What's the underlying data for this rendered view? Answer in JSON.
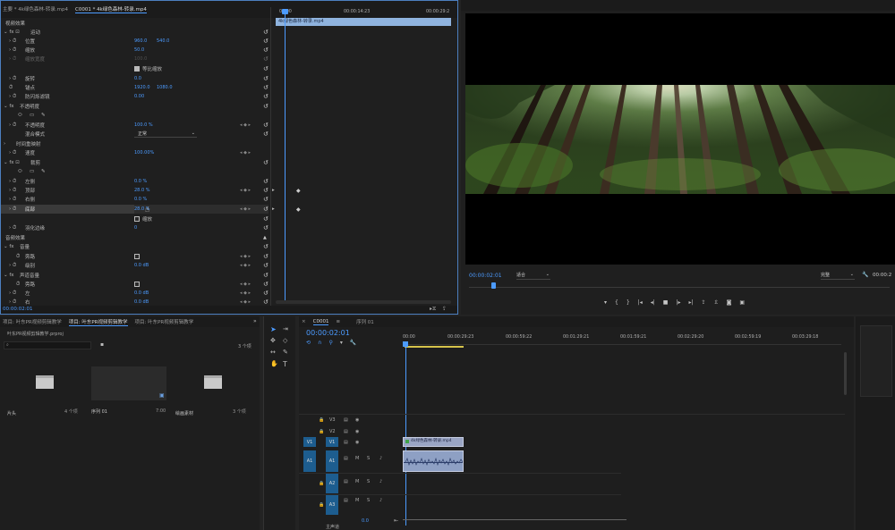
{
  "effect_controls": {
    "tabs": [
      "主要 * 4k绿色森林-转录.mp4",
      "C0001 * 4k绿色森林-转录.mp4"
    ],
    "section_video": "视频效果",
    "motion": {
      "name": "运动",
      "position": {
        "label": "位置",
        "x": "960.0",
        "y": "540.0"
      },
      "scale": {
        "label": "缩放",
        "value": "50.0"
      },
      "scale_width": {
        "label": "缩放宽度",
        "value": "100.0"
      },
      "uniform_scale": "等比缩放",
      "rotation": {
        "label": "旋转",
        "value": "0.0"
      },
      "anchor": {
        "label": "锚点",
        "x": "1920.0",
        "y": "1080.0"
      },
      "anti_flicker": {
        "label": "防闪烁滤镜",
        "value": "0.00"
      }
    },
    "opacity": {
      "name": "不透明度",
      "opacity": {
        "label": "不透明度",
        "value": "100.0 %"
      },
      "blend_mode": {
        "label": "混合模式",
        "value": "正常"
      }
    },
    "time_remap": {
      "name": "时间重映射",
      "speed": {
        "label": "速度",
        "value": "100.00%"
      }
    },
    "crop": {
      "name": "裁剪",
      "left": {
        "label": "左侧",
        "value": "0.0 %"
      },
      "top": {
        "label": "顶部",
        "value": "28.0 %"
      },
      "right": {
        "label": "右侧",
        "value": "0.0 %"
      },
      "bottom": {
        "label": "底部",
        "value": "28.0 %"
      },
      "zoom": "缩放",
      "feather": {
        "label": "羽化边缘",
        "value": "0"
      }
    },
    "section_audio": "音频效果",
    "volume": {
      "name": "音量",
      "bypass": "旁路",
      "level": {
        "label": "级别",
        "value": "0.0 dB"
      }
    },
    "channel_volume": {
      "name": "声道音量",
      "bypass": "旁路",
      "left": {
        "label": "左",
        "value": "0.0 dB"
      },
      "right": {
        "label": "右",
        "value": "0.0 dB"
      }
    },
    "timecode": "00:00:02:01",
    "ruler": [
      "00:00",
      "00:00:14:23",
      "00:00:29:2"
    ],
    "clip_label": "4k绿色森林-转录.mp4"
  },
  "program": {
    "timecode": "00:00:02:01",
    "fit": "适合",
    "quality": "完整",
    "duration": "00:00:2"
  },
  "project": {
    "tabs": [
      "项目: 叶东PR视频剪辑教学",
      "项目: 叶东PR视频剪辑教学",
      "项目: 叶东PR视频剪辑教学"
    ],
    "path": "叶东PR视频剪辑教学.prproj",
    "count": "3 个项",
    "bins": [
      {
        "name": "片头",
        "meta": "4 个项"
      },
      {
        "name": "序列 01",
        "meta": "7:00"
      },
      {
        "name": "绘画素材",
        "meta": "3 个项"
      }
    ]
  },
  "timeline": {
    "tab": "C0001",
    "tab2": "序列 01",
    "timecode": "00:00:02:01",
    "ruler": [
      "00:00",
      "00:00:29:23",
      "00:00:59:22",
      "00:01:29:21",
      "00:01:59:21",
      "00:02:29:20",
      "00:02:59:19",
      "00:03:29:18"
    ],
    "tracks_video": [
      "V3",
      "V2",
      "V1"
    ],
    "tracks_audio": [
      "A1",
      "A2",
      "A3"
    ],
    "src_v": "V1",
    "src_a": "A1",
    "clip_name": "4k绿色森林-转录.mp4",
    "master": "主声道",
    "master_value": "0.0"
  },
  "colors": {
    "accent": "#4c9bff",
    "track": "#1d5d8f",
    "clip_video": "#9aa5c4",
    "clip_audio": "#8ea0c4"
  }
}
